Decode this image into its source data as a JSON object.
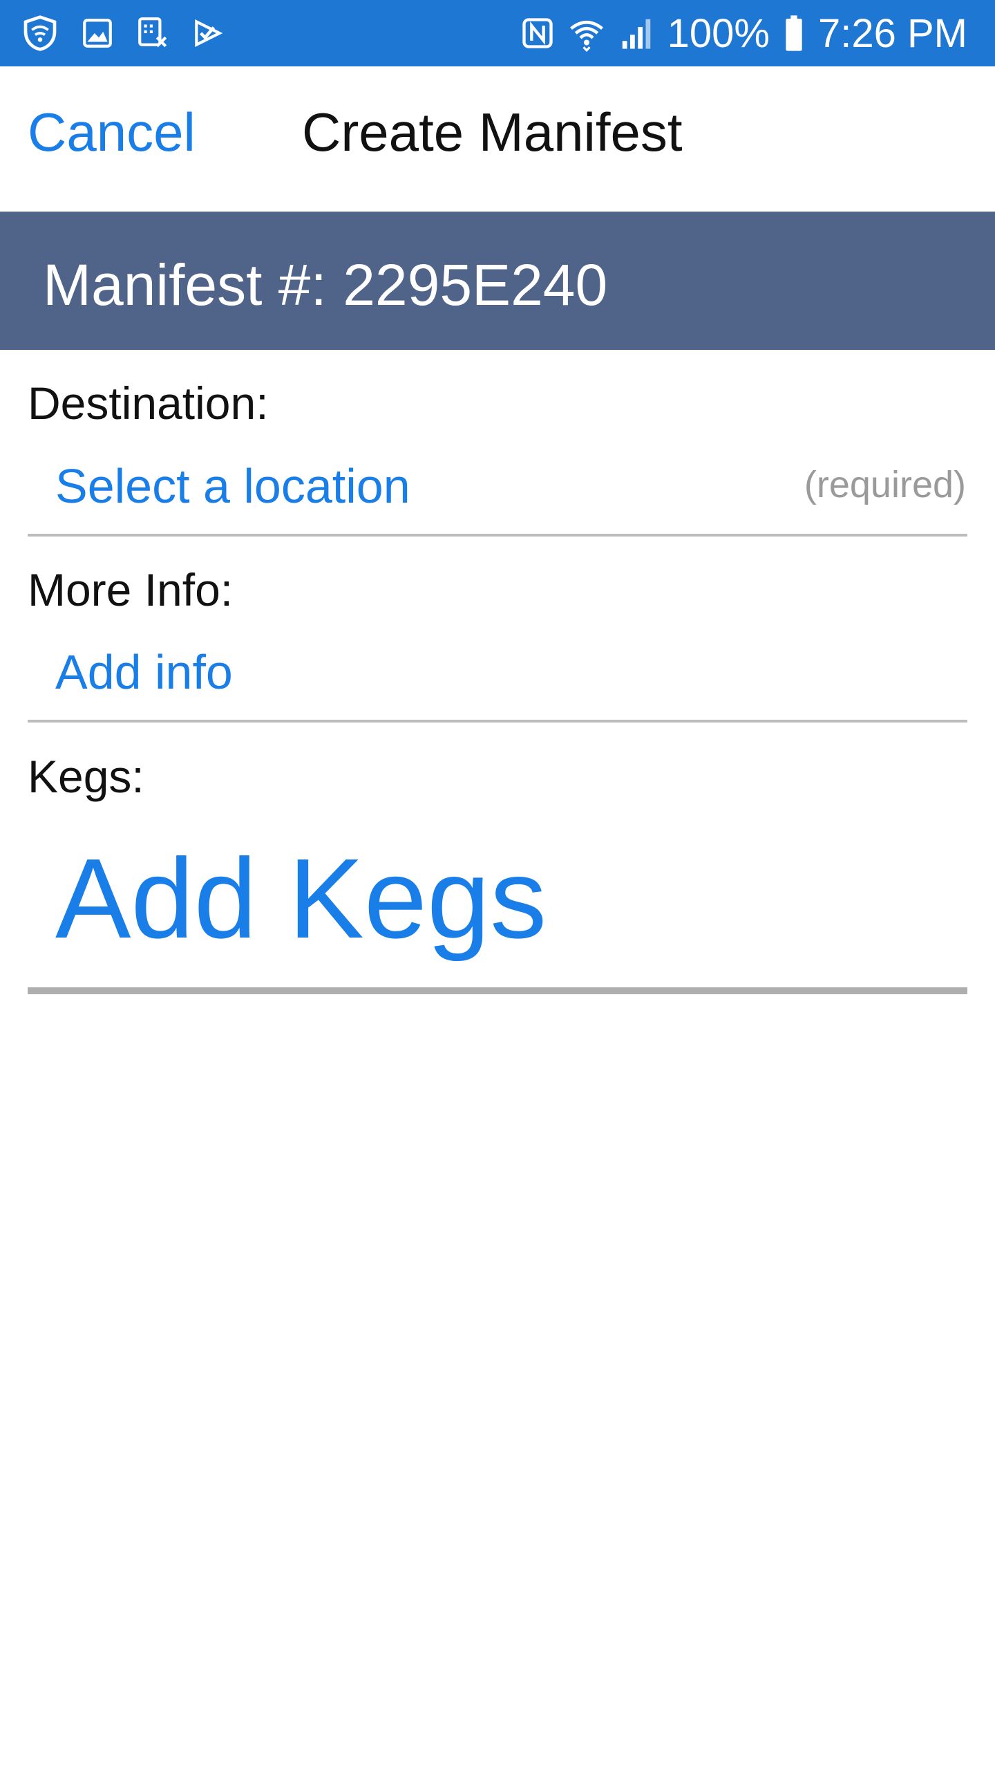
{
  "status_bar": {
    "icons_left": [
      "shield-icon",
      "image-icon",
      "keypad-icon",
      "check-icon"
    ],
    "icons_right": [
      "nfc-icon",
      "wifi-icon",
      "signal-icon"
    ],
    "battery_percent": "100%",
    "time": "7:26 PM",
    "color": "#1e77d3"
  },
  "header": {
    "cancel_label": "Cancel",
    "title": "Create Manifest"
  },
  "manifest": {
    "label": "Manifest #: 2295E240",
    "banner_color": "#506388"
  },
  "destination": {
    "label": "Destination:",
    "value": "Select a location",
    "hint": "(required)"
  },
  "more_info": {
    "label": "More Info:",
    "value": "Add info"
  },
  "kegs": {
    "label": "Kegs:",
    "add_label": "Add Kegs"
  },
  "colors": {
    "accent": "#1a7ee8",
    "hint": "#9a9a9a"
  }
}
